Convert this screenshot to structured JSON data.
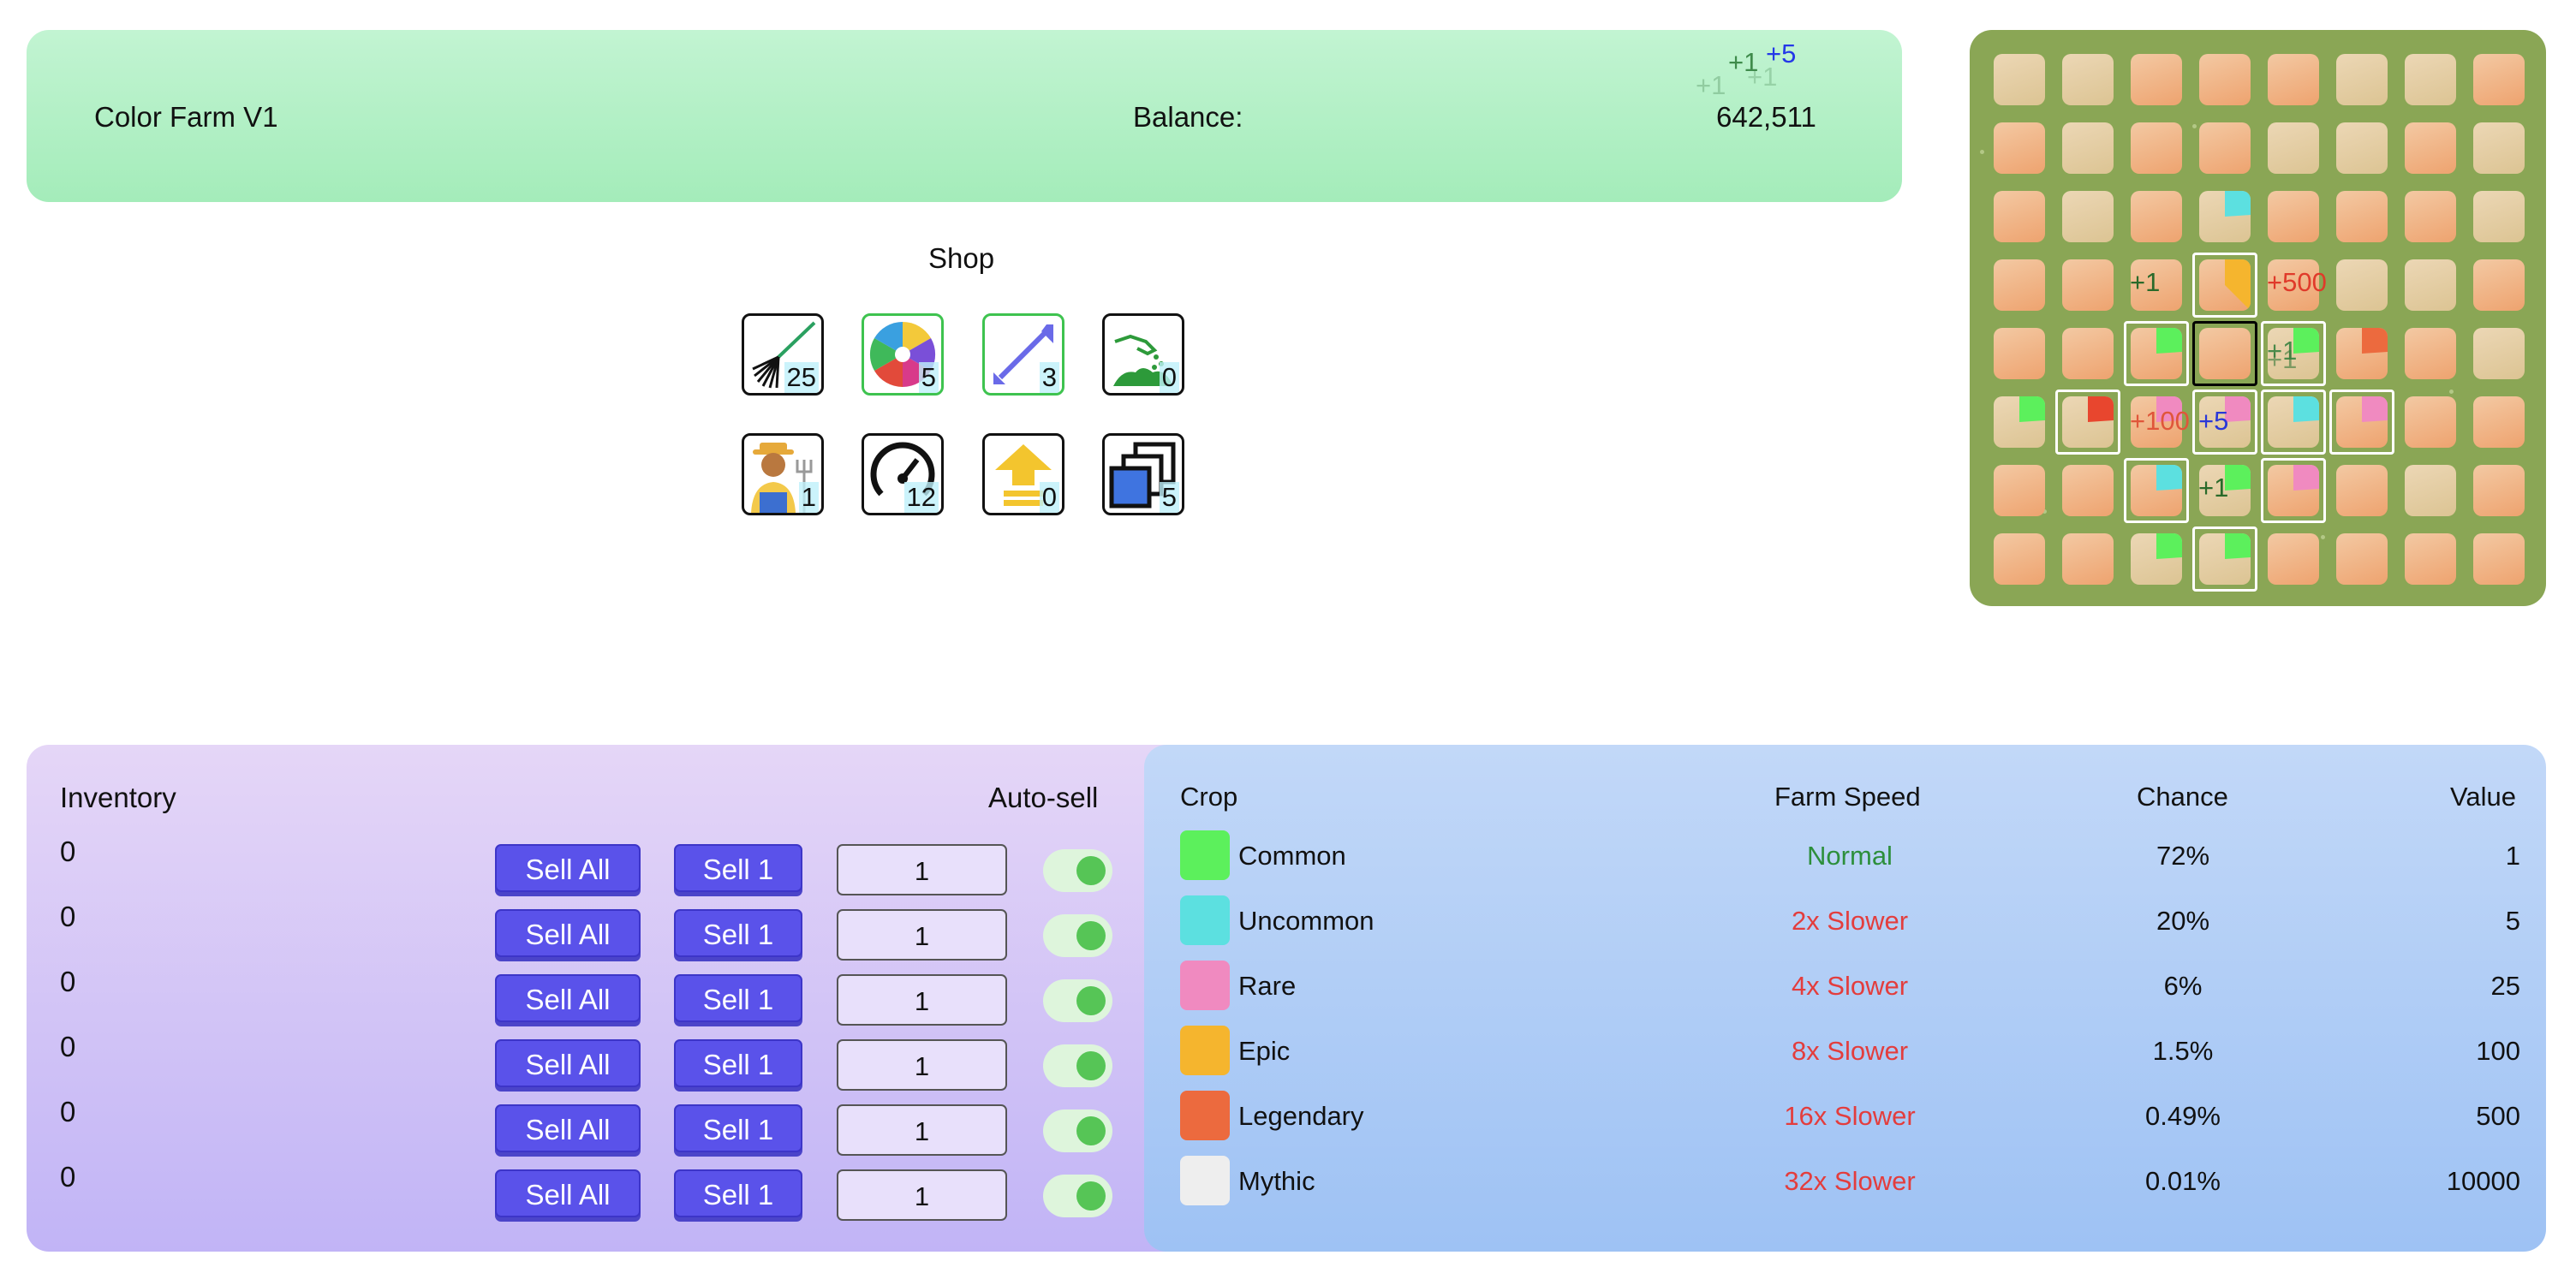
{
  "app": {
    "title": "Color Farm V1"
  },
  "header": {
    "balance_label": "Balance:",
    "balance_value": "642,511",
    "floaters": [
      "+5",
      "+1",
      "+1",
      "+1"
    ]
  },
  "shop": {
    "title": "Shop",
    "items": [
      {
        "icon": "rake-icon",
        "count": "25"
      },
      {
        "icon": "color-wheel-icon",
        "count": "5"
      },
      {
        "icon": "expand-arrow-icon",
        "count": "3"
      },
      {
        "icon": "seed-hand-icon",
        "count": "0"
      },
      {
        "icon": "farmer-icon",
        "count": "1"
      },
      {
        "icon": "speedometer-icon",
        "count": "12"
      },
      {
        "icon": "upgrade-arrow-icon",
        "count": "0"
      },
      {
        "icon": "layers-icon",
        "count": "5"
      }
    ]
  },
  "farm": {
    "floaters": [
      "+1",
      "+500",
      "+1",
      "+1",
      "+100",
      "+5",
      "+1"
    ]
  },
  "inventory": {
    "title": "Inventory",
    "auto_sell_label": "Auto-sell",
    "sell_all_label": "Sell All",
    "sell_one_label": "Sell 1",
    "rows": [
      {
        "count": "0",
        "qty": "1",
        "auto_sell": true
      },
      {
        "count": "0",
        "qty": "1",
        "auto_sell": true
      },
      {
        "count": "0",
        "qty": "1",
        "auto_sell": true
      },
      {
        "count": "0",
        "qty": "1",
        "auto_sell": true
      },
      {
        "count": "0",
        "qty": "1",
        "auto_sell": true
      },
      {
        "count": "0",
        "qty": "1",
        "auto_sell": true
      }
    ]
  },
  "crops": {
    "headers": {
      "crop": "Crop",
      "speed": "Farm Speed",
      "chance": "Chance",
      "value": "Value"
    },
    "rows": [
      {
        "name": "Common",
        "speed": "Normal",
        "chance": "72%",
        "value": "1",
        "color": "#5cf05c"
      },
      {
        "name": "Uncommon",
        "speed": "2x Slower",
        "chance": "20%",
        "value": "5",
        "color": "#5ce0e0"
      },
      {
        "name": "Rare",
        "speed": "4x Slower",
        "chance": "6%",
        "value": "25",
        "color": "#f08ac0"
      },
      {
        "name": "Epic",
        "speed": "8x Slower",
        "chance": "1.5%",
        "value": "100",
        "color": "#f5b52e"
      },
      {
        "name": "Legendary",
        "speed": "16x Slower",
        "chance": "0.49%",
        "value": "500",
        "color": "#ec6a3e"
      },
      {
        "name": "Mythic",
        "speed": "32x Slower",
        "chance": "0.01%",
        "value": "10000",
        "color": "#eeeeee"
      }
    ],
    "colors": {
      "normal": "#2d8f3c",
      "slower": "#e33d3d"
    }
  }
}
